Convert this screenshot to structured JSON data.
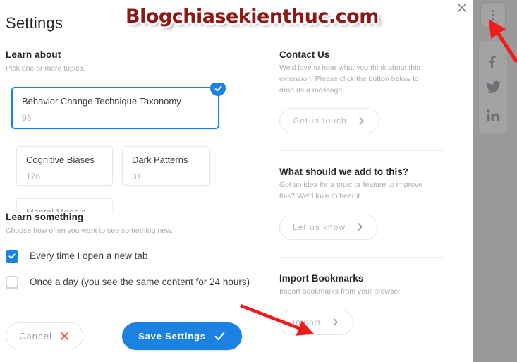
{
  "window": {
    "title": "Settings",
    "close_icon": "close-x-icon"
  },
  "watermark": {
    "text": "Blogchiasekienthuc.com",
    "color": "#8b1a17"
  },
  "theme": {
    "accent": "#1b82e2",
    "muted_text": "#a7adb3",
    "body_text": "#3c4043",
    "overlay": "#9a9a9a",
    "annotation_arrow": "#f01b1b"
  },
  "learn_about": {
    "title": "Learn about",
    "subtitle": "Pick one or more topics.",
    "topics": [
      {
        "name": "Behavior Change Technique Taxonomy",
        "count": "93",
        "selected": true
      },
      {
        "name": "Cognitive Biases",
        "count": "176",
        "selected": false
      },
      {
        "name": "Dark Patterns",
        "count": "31",
        "selected": false
      },
      {
        "name": "Mental Models",
        "count": "",
        "selected": false
      }
    ],
    "selected_badge_icon": "check-circle-icon"
  },
  "learn_something": {
    "title": "Learn something",
    "subtitle": "Choose how often you want to see something new.",
    "options": [
      {
        "label": "Every time I open a new tab",
        "checked": true
      },
      {
        "label": "Once a day (you see the same content for 24 hours)",
        "checked": false
      }
    ]
  },
  "footer": {
    "cancel_label": "Cancel",
    "cancel_icon": "x-mark-icon",
    "save_label": "Save Settings",
    "save_icon": "check-mark-icon"
  },
  "right_column": {
    "contact": {
      "title": "Contact Us",
      "body": "We'd love to hear what you think about this extension. Please click the button below to drop us a message.",
      "button_label": "Get in touch",
      "button_icon": "chevron-right-icon"
    },
    "suggest": {
      "title": "What should we add to this?",
      "body": "Got an idea for a topic or feature to improve this? We'd love to hear it.",
      "button_label": "Let us know",
      "button_icon": "chevron-right-icon"
    },
    "import": {
      "title": "Import Bookmarks",
      "body": "Import bookmarks from your browser.",
      "button_label": "Import",
      "button_icon": "chevron-right-icon"
    }
  },
  "browser_sidebar": {
    "menu_icon": "kebab-menu-icon",
    "social": [
      {
        "icon": "facebook-icon"
      },
      {
        "icon": "twitter-icon"
      },
      {
        "icon": "linkedin-icon"
      }
    ]
  }
}
